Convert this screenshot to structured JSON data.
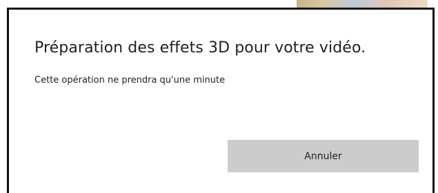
{
  "dialog": {
    "title": "Préparation des effets 3D pour votre vidéo.",
    "message": "Cette opération ne prendra qu'une minute",
    "cancel_label": "Annuler"
  },
  "colors": {
    "dialog_background": "#ffffff",
    "dialog_border": "#111111",
    "button_background": "#cccccc",
    "text": "#1f1f1f"
  }
}
